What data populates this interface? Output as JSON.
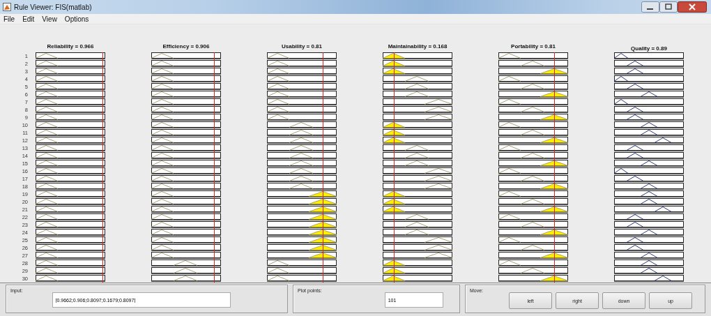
{
  "window": {
    "title": "Rule Viewer: FIS(matlab)"
  },
  "menu": [
    {
      "label": "File"
    },
    {
      "label": "Edit"
    },
    {
      "label": "View"
    },
    {
      "label": "Options"
    }
  ],
  "columns": [
    {
      "title": "Reliability = 0.966",
      "kind": "input",
      "level": 0.966
    },
    {
      "title": "Efficiency = 0.906",
      "kind": "input",
      "level": 0.906
    },
    {
      "title": "Usability = 0.81",
      "kind": "input",
      "level": 0.81
    },
    {
      "title": "Maintainability = 0.168",
      "kind": "input",
      "level": 0.168
    },
    {
      "title": "Portability = 0.81",
      "kind": "input",
      "level": 0.81
    },
    {
      "title": "Quality = 0.89",
      "kind": "output"
    }
  ],
  "rules": [
    {
      "number": "1",
      "cells": [
        {
          "kind": "low"
        },
        {
          "kind": "low"
        },
        {
          "kind": "low"
        },
        {
          "kind": "low"
        },
        {
          "kind": "low"
        },
        {
          "kind": "very_low"
        }
      ]
    },
    {
      "number": "2",
      "cells": [
        {
          "kind": "low"
        },
        {
          "kind": "low"
        },
        {
          "kind": "low"
        },
        {
          "kind": "low"
        },
        {
          "kind": "medium"
        },
        {
          "kind": "low"
        }
      ]
    },
    {
      "number": "3",
      "cells": [
        {
          "kind": "low"
        },
        {
          "kind": "low"
        },
        {
          "kind": "low"
        },
        {
          "kind": "low"
        },
        {
          "kind": "high"
        },
        {
          "kind": "low"
        }
      ]
    },
    {
      "number": "4",
      "cells": [
        {
          "kind": "low"
        },
        {
          "kind": "low"
        },
        {
          "kind": "low"
        },
        {
          "kind": "medium"
        },
        {
          "kind": "low"
        },
        {
          "kind": "very_low"
        }
      ]
    },
    {
      "number": "5",
      "cells": [
        {
          "kind": "low"
        },
        {
          "kind": "low"
        },
        {
          "kind": "low"
        },
        {
          "kind": "medium"
        },
        {
          "kind": "medium"
        },
        {
          "kind": "low"
        }
      ]
    },
    {
      "number": "6",
      "cells": [
        {
          "kind": "low"
        },
        {
          "kind": "low"
        },
        {
          "kind": "low"
        },
        {
          "kind": "medium"
        },
        {
          "kind": "high"
        },
        {
          "kind": "medium"
        }
      ]
    },
    {
      "number": "7",
      "cells": [
        {
          "kind": "low"
        },
        {
          "kind": "low"
        },
        {
          "kind": "low"
        },
        {
          "kind": "high"
        },
        {
          "kind": "low"
        },
        {
          "kind": "very_low"
        }
      ]
    },
    {
      "number": "8",
      "cells": [
        {
          "kind": "low"
        },
        {
          "kind": "low"
        },
        {
          "kind": "low"
        },
        {
          "kind": "high"
        },
        {
          "kind": "medium"
        },
        {
          "kind": "low"
        }
      ]
    },
    {
      "number": "9",
      "cells": [
        {
          "kind": "low"
        },
        {
          "kind": "low"
        },
        {
          "kind": "low"
        },
        {
          "kind": "high"
        },
        {
          "kind": "high"
        },
        {
          "kind": "low"
        }
      ]
    },
    {
      "number": "10",
      "cells": [
        {
          "kind": "low"
        },
        {
          "kind": "low"
        },
        {
          "kind": "medium"
        },
        {
          "kind": "low"
        },
        {
          "kind": "low"
        },
        {
          "kind": "medium"
        }
      ]
    },
    {
      "number": "11",
      "cells": [
        {
          "kind": "low"
        },
        {
          "kind": "low"
        },
        {
          "kind": "medium"
        },
        {
          "kind": "low"
        },
        {
          "kind": "medium"
        },
        {
          "kind": "medium"
        }
      ]
    },
    {
      "number": "12",
      "cells": [
        {
          "kind": "low"
        },
        {
          "kind": "low"
        },
        {
          "kind": "medium"
        },
        {
          "kind": "low"
        },
        {
          "kind": "high"
        },
        {
          "kind": "high"
        }
      ]
    },
    {
      "number": "13",
      "cells": [
        {
          "kind": "low"
        },
        {
          "kind": "low"
        },
        {
          "kind": "medium"
        },
        {
          "kind": "medium"
        },
        {
          "kind": "low"
        },
        {
          "kind": "low"
        }
      ]
    },
    {
      "number": "14",
      "cells": [
        {
          "kind": "low"
        },
        {
          "kind": "low"
        },
        {
          "kind": "medium"
        },
        {
          "kind": "medium"
        },
        {
          "kind": "medium"
        },
        {
          "kind": "low"
        }
      ]
    },
    {
      "number": "15",
      "cells": [
        {
          "kind": "low"
        },
        {
          "kind": "low"
        },
        {
          "kind": "medium"
        },
        {
          "kind": "medium"
        },
        {
          "kind": "high"
        },
        {
          "kind": "medium"
        }
      ]
    },
    {
      "number": "16",
      "cells": [
        {
          "kind": "low"
        },
        {
          "kind": "low"
        },
        {
          "kind": "medium"
        },
        {
          "kind": "high"
        },
        {
          "kind": "low"
        },
        {
          "kind": "very_low"
        }
      ]
    },
    {
      "number": "17",
      "cells": [
        {
          "kind": "low"
        },
        {
          "kind": "low"
        },
        {
          "kind": "medium"
        },
        {
          "kind": "high"
        },
        {
          "kind": "medium"
        },
        {
          "kind": "low"
        }
      ]
    },
    {
      "number": "18",
      "cells": [
        {
          "kind": "low"
        },
        {
          "kind": "low"
        },
        {
          "kind": "medium"
        },
        {
          "kind": "high"
        },
        {
          "kind": "high"
        },
        {
          "kind": "medium"
        }
      ]
    },
    {
      "number": "19",
      "cells": [
        {
          "kind": "low"
        },
        {
          "kind": "low"
        },
        {
          "kind": "high"
        },
        {
          "kind": "low"
        },
        {
          "kind": "low"
        },
        {
          "kind": "medium"
        }
      ]
    },
    {
      "number": "20",
      "cells": [
        {
          "kind": "low"
        },
        {
          "kind": "low"
        },
        {
          "kind": "high"
        },
        {
          "kind": "low"
        },
        {
          "kind": "medium"
        },
        {
          "kind": "medium"
        }
      ]
    },
    {
      "number": "21",
      "cells": [
        {
          "kind": "low"
        },
        {
          "kind": "low"
        },
        {
          "kind": "high"
        },
        {
          "kind": "low"
        },
        {
          "kind": "high"
        },
        {
          "kind": "high"
        }
      ]
    },
    {
      "number": "22",
      "cells": [
        {
          "kind": "low"
        },
        {
          "kind": "low"
        },
        {
          "kind": "high"
        },
        {
          "kind": "medium"
        },
        {
          "kind": "low"
        },
        {
          "kind": "low"
        }
      ]
    },
    {
      "number": "23",
      "cells": [
        {
          "kind": "low"
        },
        {
          "kind": "low"
        },
        {
          "kind": "high"
        },
        {
          "kind": "medium"
        },
        {
          "kind": "medium"
        },
        {
          "kind": "low"
        }
      ]
    },
    {
      "number": "24",
      "cells": [
        {
          "kind": "low"
        },
        {
          "kind": "low"
        },
        {
          "kind": "high"
        },
        {
          "kind": "medium"
        },
        {
          "kind": "high"
        },
        {
          "kind": "medium"
        }
      ]
    },
    {
      "number": "25",
      "cells": [
        {
          "kind": "low"
        },
        {
          "kind": "low"
        },
        {
          "kind": "high"
        },
        {
          "kind": "high"
        },
        {
          "kind": "low"
        },
        {
          "kind": "low"
        }
      ]
    },
    {
      "number": "26",
      "cells": [
        {
          "kind": "low"
        },
        {
          "kind": "low"
        },
        {
          "kind": "high"
        },
        {
          "kind": "high"
        },
        {
          "kind": "medium"
        },
        {
          "kind": "low"
        }
      ]
    },
    {
      "number": "27",
      "cells": [
        {
          "kind": "low"
        },
        {
          "kind": "low"
        },
        {
          "kind": "high"
        },
        {
          "kind": "high"
        },
        {
          "kind": "high"
        },
        {
          "kind": "medium"
        }
      ]
    },
    {
      "number": "28",
      "cells": [
        {
          "kind": "low"
        },
        {
          "kind": "medium"
        },
        {
          "kind": "low"
        },
        {
          "kind": "low"
        },
        {
          "kind": "low"
        },
        {
          "kind": "medium"
        }
      ]
    },
    {
      "number": "29",
      "cells": [
        {
          "kind": "low"
        },
        {
          "kind": "medium"
        },
        {
          "kind": "low"
        },
        {
          "kind": "low"
        },
        {
          "kind": "medium"
        },
        {
          "kind": "medium"
        }
      ]
    },
    {
      "number": "30",
      "cells": [
        {
          "kind": "low"
        },
        {
          "kind": "medium"
        },
        {
          "kind": "low"
        },
        {
          "kind": "low"
        },
        {
          "kind": "high"
        },
        {
          "kind": "high"
        }
      ]
    }
  ],
  "input_panel": {
    "label": "Input:",
    "value": "[0.9662;0.906;0.8097;0.1679;0.8097]"
  },
  "plot_points_panel": {
    "label": "Plot points:",
    "value": "101"
  },
  "move_panel": {
    "label": "Move:",
    "buttons": [
      "left",
      "right",
      "down",
      "up"
    ]
  }
}
